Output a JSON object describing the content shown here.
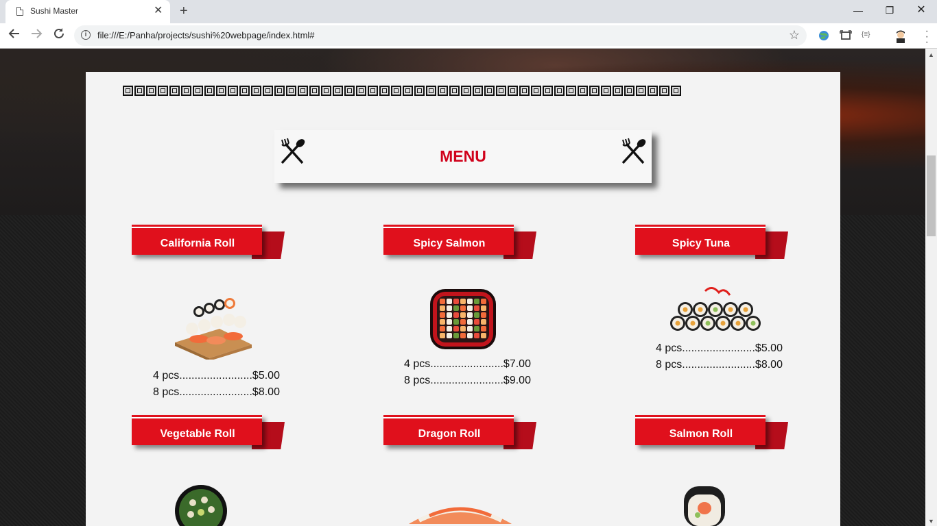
{
  "browser": {
    "tab_title": "Sushi Master",
    "tab_close": "✕",
    "new_tab": "+",
    "url": "file:///E:/Panha/projects/sushi%20webpage/index.html#",
    "minimize": "—",
    "restore": "❐",
    "close": "✕"
  },
  "menu": {
    "title": "MENU"
  },
  "items": [
    {
      "name": "California Roll",
      "prices": [
        "4 pcs........................$5.00",
        "8 pcs........................$8.00"
      ]
    },
    {
      "name": "Spicy Salmon",
      "prices": [
        "4 pcs........................$7.00",
        "8 pcs........................$9.00"
      ]
    },
    {
      "name": "Spicy Tuna",
      "prices": [
        "4 pcs........................$5.00",
        "8 pcs........................$8.00"
      ]
    },
    {
      "name": "Vegetable Roll",
      "prices": []
    },
    {
      "name": "Dragon Roll",
      "prices": []
    },
    {
      "name": "Salmon Roll",
      "prices": []
    }
  ],
  "colors": {
    "accent_red": "#e0101c",
    "title_red": "#d0021b"
  }
}
